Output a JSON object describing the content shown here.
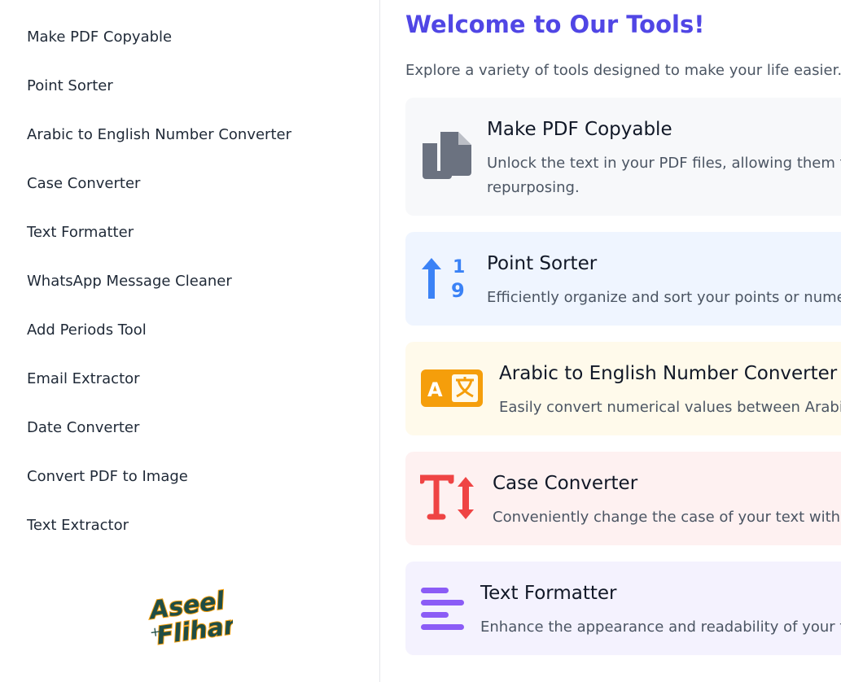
{
  "sidebar": {
    "items": [
      {
        "label": "Make PDF Copyable"
      },
      {
        "label": "Point Sorter"
      },
      {
        "label": "Arabic to English Number Converter"
      },
      {
        "label": "Case Converter"
      },
      {
        "label": "Text Formatter"
      },
      {
        "label": "WhatsApp Message Cleaner"
      },
      {
        "label": "Add Periods Tool"
      },
      {
        "label": "Email Extractor"
      },
      {
        "label": "Date Converter"
      },
      {
        "label": "Convert PDF to Image"
      },
      {
        "label": "Text Extractor"
      }
    ],
    "logo": {
      "line1": "Aseel",
      "line2": "Flihan"
    }
  },
  "main": {
    "title": "Welcome to Our Tools!",
    "subtitle": "Explore a variety of tools designed to make your life easier.",
    "cards": [
      {
        "title": "Make PDF Copyable",
        "desc_line1": "Unlock the text in your PDF files, allowing them to",
        "desc_line2": "repurposing.",
        "icon": "copy-icon",
        "bg": "#f7f8fa",
        "icon_color": "#6b7280"
      },
      {
        "title": "Point Sorter",
        "desc_line1": "Efficiently organize and sort your points or numer",
        "icon": "sort-numeric-up-icon",
        "bg": "#eff5ff",
        "icon_color": "#3b82f6"
      },
      {
        "title": "Arabic to English Number Converter",
        "desc_line1": "Easily convert numerical values between Arabic",
        "icon": "language-translate-icon",
        "bg": "#fffaeb",
        "icon_color": "#f59e0b"
      },
      {
        "title": "Case Converter",
        "desc_line1": "Conveniently change the case of your text with a",
        "icon": "text-height-icon",
        "bg": "#fef1f1",
        "icon_color": "#ef4444"
      },
      {
        "title": "Text Formatter",
        "desc_line1": "Enhance the appearance and readability of your te",
        "icon": "align-left-icon",
        "bg": "#f4f2fe",
        "icon_color": "#8b5cf6"
      }
    ]
  }
}
